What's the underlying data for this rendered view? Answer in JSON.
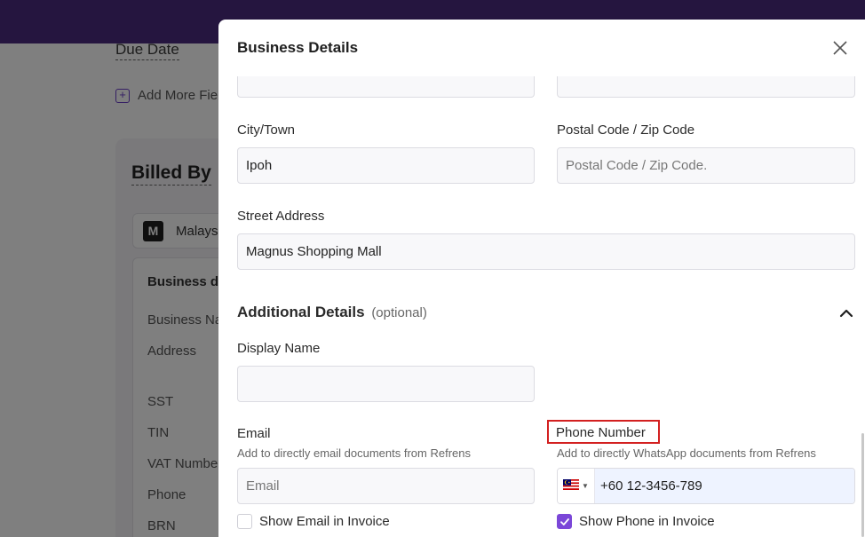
{
  "background": {
    "due_date_label": "Due Date",
    "add_more_fields_label": "Add More Fie",
    "billed_by_title": "Billed By",
    "business_initial": "M",
    "business_name_truncated": "Malays",
    "business_details_title": "Business de",
    "rows": [
      "Business Na",
      "Address",
      "SST",
      "TIN",
      "VAT Numbe",
      "Phone",
      "BRN"
    ]
  },
  "modal": {
    "title": "Business Details",
    "city": {
      "label": "City/Town",
      "value": "Ipoh",
      "placeholder": ""
    },
    "postal": {
      "label": "Postal Code / Zip Code",
      "value": "",
      "placeholder": "Postal Code / Zip Code."
    },
    "street": {
      "label": "Street Address",
      "value": "Magnus Shopping Mall",
      "placeholder": ""
    },
    "additional": {
      "title": "Additional Details",
      "optional": "(optional)",
      "expanded": true
    },
    "display_name": {
      "label": "Display Name",
      "value": "",
      "placeholder": ""
    },
    "email": {
      "label": "Email",
      "hint": "Add to directly email documents from Refrens",
      "value": "",
      "placeholder": "Email"
    },
    "phone": {
      "label": "Phone Number",
      "hint": "Add to directly WhatsApp documents from Refrens",
      "country_flag": "malaysia-flag",
      "value": "+60 12-3456-789"
    },
    "show_email": {
      "label": "Show Email in Invoice",
      "checked": false
    },
    "show_phone": {
      "label": "Show Phone in Invoice",
      "checked": true
    }
  },
  "colors": {
    "topbar": "#4a2a7e",
    "accent": "#7b47d8",
    "highlight_border": "#d32020"
  }
}
